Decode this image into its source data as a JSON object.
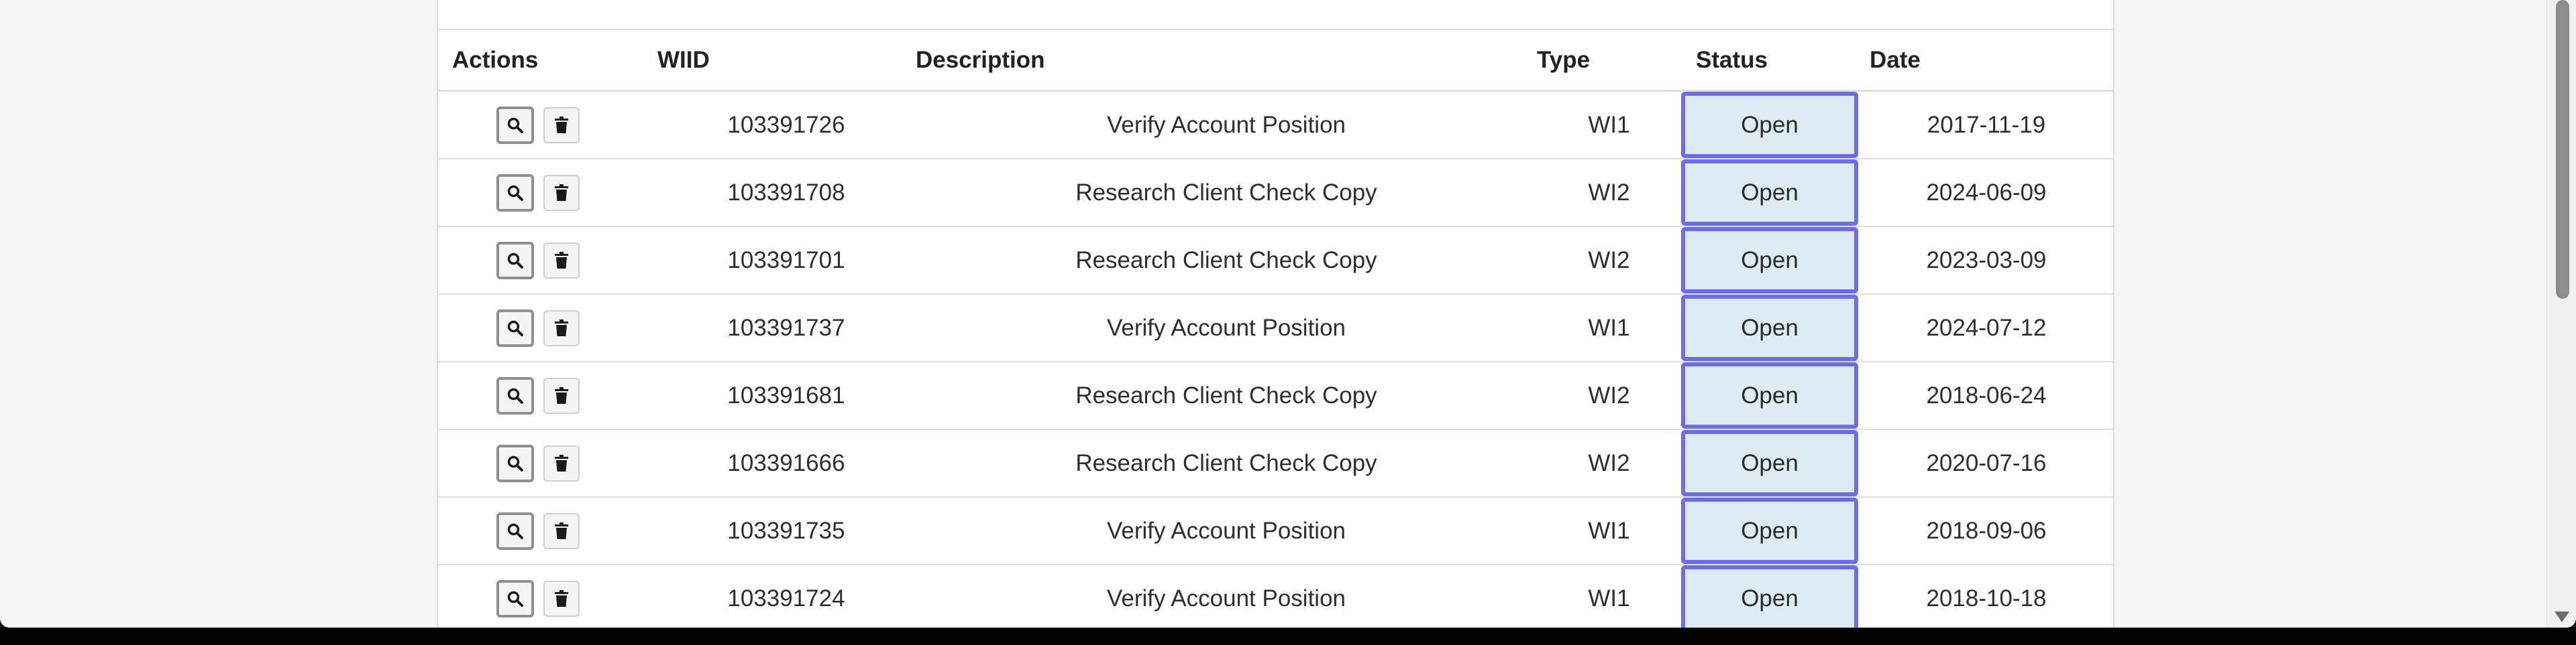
{
  "table": {
    "headers": {
      "actions": "Actions",
      "wiid": "WIID",
      "description": "Description",
      "type": "Type",
      "status": "Status",
      "date": "Date"
    },
    "rows": [
      {
        "wiid": "103391726",
        "description": "Verify Account Position",
        "type": "WI1",
        "status": "Open",
        "date": "2017-11-19"
      },
      {
        "wiid": "103391708",
        "description": "Research Client Check Copy",
        "type": "WI2",
        "status": "Open",
        "date": "2024-06-09"
      },
      {
        "wiid": "103391701",
        "description": "Research Client Check Copy",
        "type": "WI2",
        "status": "Open",
        "date": "2023-03-09"
      },
      {
        "wiid": "103391737",
        "description": "Verify Account Position",
        "type": "WI1",
        "status": "Open",
        "date": "2024-07-12"
      },
      {
        "wiid": "103391681",
        "description": "Research Client Check Copy",
        "type": "WI2",
        "status": "Open",
        "date": "2018-06-24"
      },
      {
        "wiid": "103391666",
        "description": "Research Client Check Copy",
        "type": "WI2",
        "status": "Open",
        "date": "2020-07-16"
      },
      {
        "wiid": "103391735",
        "description": "Verify Account Position",
        "type": "WI1",
        "status": "Open",
        "date": "2018-09-06"
      },
      {
        "wiid": "103391724",
        "description": "Verify Account Position",
        "type": "WI1",
        "status": "Open",
        "date": "2018-10-18"
      }
    ]
  },
  "icons": {
    "view": "search-icon",
    "delete": "trash-icon"
  },
  "colors": {
    "status_fill": "#dcecf2",
    "status_border": "#6d6af4"
  }
}
